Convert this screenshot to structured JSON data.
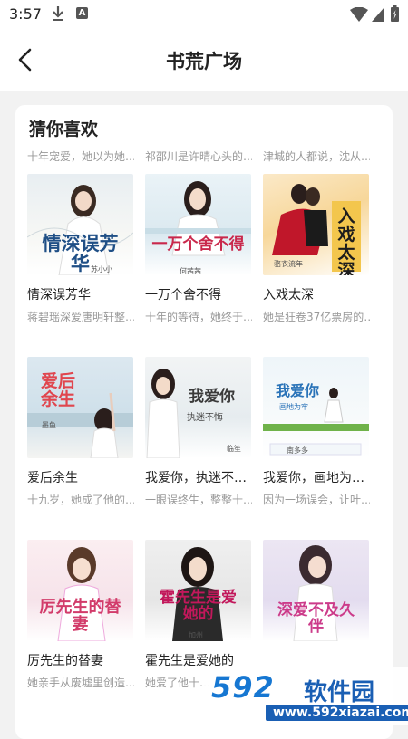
{
  "status": {
    "time": "3:57",
    "a_badge": "A"
  },
  "header": {
    "title": "书荒广场"
  },
  "section": {
    "title": "猜你喜欢",
    "hints": [
      "十年宠爱，她以为她…",
      "祁邵川是许晴心头的…",
      "津城的人都说，沈从…"
    ]
  },
  "books": [
    {
      "title": "情深误芳华",
      "desc": "蒋碧瑶深爱唐明轩整…",
      "cover_text": "情深误芳华",
      "cover_author": "苏小小",
      "cover_color": "#1f4f86"
    },
    {
      "title": "一万个舍不得",
      "desc": "十年的等待，她终于…",
      "cover_text": "一万个舍不得",
      "cover_author": "何茜茜",
      "cover_color": "#c9284b"
    },
    {
      "title": "入戏太深",
      "desc": "她是狂卷37亿票房的…",
      "cover_text": "入戏太深",
      "cover_author": "骆衣流年",
      "cover_color": "#1d1d1d"
    },
    {
      "title": "爱后余生",
      "desc": "十九岁，她成了他的…",
      "cover_text": "爱后余生",
      "cover_author": "墨鱼",
      "cover_color": "#e0464e"
    },
    {
      "title": "我爱你，执迷不…",
      "desc": "一眼误终生，整整十…",
      "cover_text": "我爱你",
      "cover_sub": "执迷不悔",
      "cover_author": "临笙",
      "cover_color": "#3a3a3a"
    },
    {
      "title": "我爱你，画地为…",
      "desc": "因为一场误会，让叶…",
      "cover_text": "我爱你",
      "cover_sub": "画地为牢",
      "cover_author": "南多多",
      "cover_color": "#2a73b8"
    },
    {
      "title": "厉先生的替妻",
      "desc": "她亲手从废墟里创造…",
      "cover_text": "厉先生的替妻",
      "cover_author": "",
      "cover_color": "#d23b6a"
    },
    {
      "title": "霍先生是爱她的",
      "desc": "她爱了他十…",
      "cover_text": "霍先生是爱她的",
      "cover_author": "加州",
      "cover_color": "#c2185b"
    },
    {
      "title": "",
      "desc": "",
      "cover_text": "深爱不及久伴",
      "cover_author": "",
      "cover_color": "#cc3b8a"
    }
  ],
  "watermark": {
    "logo": "592",
    "name": "软件园",
    "url": "www.592xiazai.com"
  }
}
